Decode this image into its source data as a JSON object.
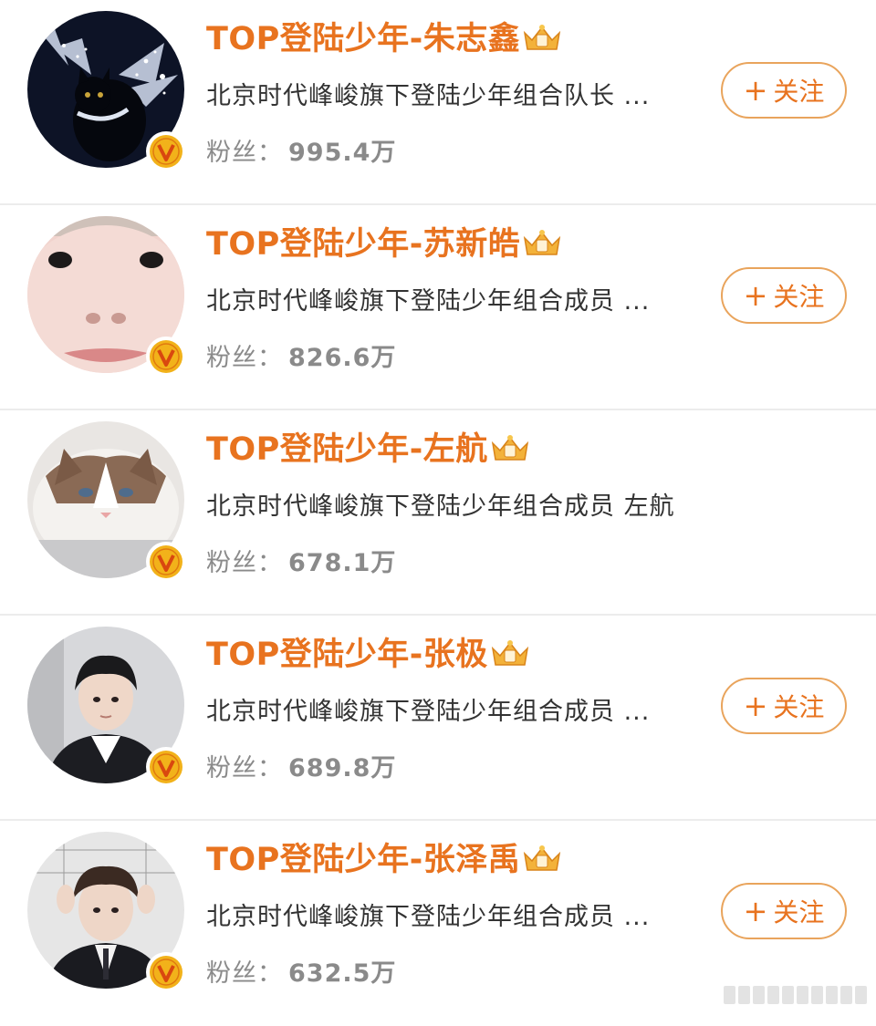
{
  "items": [
    {
      "name": "TOP登陆少年-朱志鑫",
      "desc": "北京时代峰峻旗下登陆少年组合队长 ...",
      "fans_label": "粉丝：",
      "fans_count": "995.4万",
      "follow_label": "关注",
      "avatar_icon": "black-cat-with-silver-wings",
      "has_follow": true
    },
    {
      "name": "TOP登陆少年-苏新皓",
      "desc": "北京时代峰峻旗下登陆少年组合成员 ...",
      "fans_label": "粉丝：",
      "fans_count": "826.6万",
      "follow_label": "关注",
      "avatar_icon": "face-closeup",
      "has_follow": true
    },
    {
      "name": "TOP登陆少年-左航",
      "desc": "北京时代峰峻旗下登陆少年组合成员 左航",
      "fans_label": "粉丝：",
      "fans_count": "678.1万",
      "follow_label": "",
      "avatar_icon": "ragdoll-cat",
      "has_follow": false
    },
    {
      "name": "TOP登陆少年-张极",
      "desc": "北京时代峰峻旗下登陆少年组合成员 ...",
      "fans_label": "粉丝：",
      "fans_count": "689.8万",
      "follow_label": "关注",
      "avatar_icon": "young-man-portrait",
      "has_follow": true
    },
    {
      "name": "TOP登陆少年-张泽禹",
      "desc": "北京时代峰峻旗下登陆少年组合成员 ...",
      "fans_label": "粉丝：",
      "fans_count": "632.5万",
      "follow_label": "关注",
      "avatar_icon": "young-man-hands-in-hair",
      "has_follow": true
    }
  ],
  "colors": {
    "accent": "#e8731f",
    "follow_border": "#e9a45c",
    "verified_badge": "#f2b21a",
    "fans_text": "#8a8a8a",
    "desc_text": "#333333"
  },
  "icons": {
    "verified": "verified-v-icon",
    "crown": "vip-crown-icon"
  }
}
